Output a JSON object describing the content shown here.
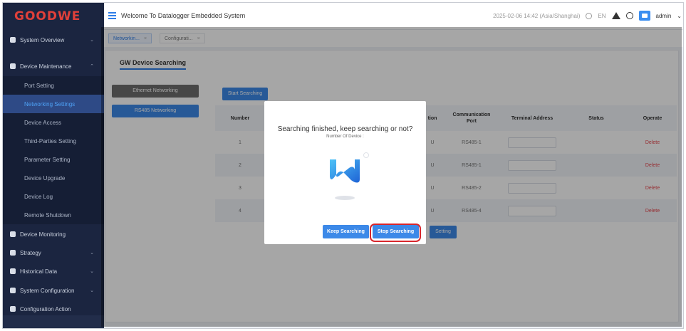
{
  "sidebar": {
    "logo": "GOODWE",
    "items": [
      {
        "label": "System Overview",
        "chevron": "⌄"
      },
      {
        "label": "Device Maintenance",
        "chevron": "⌃"
      },
      {
        "label": "Device Monitoring",
        "chevron": ""
      },
      {
        "label": "Strategy",
        "chevron": "⌄"
      },
      {
        "label": "Historical Data",
        "chevron": "⌄"
      },
      {
        "label": "System Configuration",
        "chevron": "⌄"
      },
      {
        "label": "Configuration Action",
        "chevron": ""
      }
    ],
    "sub_items": [
      {
        "label": "Port Setting"
      },
      {
        "label": "Networking Settings"
      },
      {
        "label": "Device Access"
      },
      {
        "label": "Third-Parties Setting"
      },
      {
        "label": "Parameter Setting"
      },
      {
        "label": "Device Upgrade"
      },
      {
        "label": "Device Log"
      },
      {
        "label": "Remote Shutdown"
      }
    ]
  },
  "topbar": {
    "title": "Welcome To Datalogger Embedded System",
    "datetime": "2025-02-06 14:42 (Asia/Shanghai)",
    "language": "EN",
    "user": "admin"
  },
  "tabs": [
    {
      "label": "Networkin...",
      "close": "×"
    },
    {
      "label": "Configurati...",
      "close": "×"
    }
  ],
  "panel": {
    "title": "GW Device Searching",
    "ethernet_btn": "Ethernet Networking",
    "rs485_btn": "RS485 Networking",
    "start_btn": "Start Searching",
    "setting_btn": "Setting"
  },
  "table": {
    "headers": [
      "Number",
      "tion",
      "Communication Port",
      "Terminal Address",
      "Status",
      "Operate"
    ],
    "rows": [
      {
        "number": "1",
        "partial": "U",
        "port": "RS485-1",
        "status": "",
        "operate": "Delete"
      },
      {
        "number": "2",
        "partial": "U",
        "port": "RS485-1",
        "status": "",
        "operate": "Delete"
      },
      {
        "number": "3",
        "partial": "U",
        "port": "RS485-2",
        "status": "",
        "operate": "Delete"
      },
      {
        "number": "4",
        "partial": "U",
        "port": "RS485-4",
        "status": "",
        "operate": "Delete"
      }
    ]
  },
  "dialog": {
    "title": "Searching finished, keep searching or not?",
    "count_label": "Number Of Device :",
    "keep_btn": "Keep Searching",
    "stop_btn": "Stop Searching"
  },
  "colors": {
    "accent": "#3c89e8",
    "sidebar_bg": "#1b2540",
    "brand_red": "#e0403a",
    "delete_red": "#e6474e",
    "highlight_red": "#d8262c"
  }
}
